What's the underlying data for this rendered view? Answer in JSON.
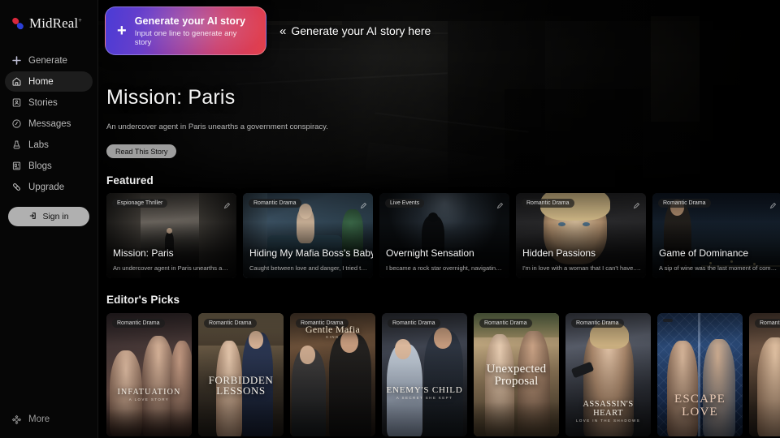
{
  "brand": {
    "name": "MidReal",
    "superscript": "+",
    "logo_icon": "pill-capsule-icon",
    "colors": {
      "pill_red": "#d8283c",
      "pill_blue": "#2b3fd8"
    }
  },
  "sidebar": {
    "items": [
      {
        "label": "Generate",
        "icon": "plus-icon",
        "active": false
      },
      {
        "label": "Home",
        "icon": "home-icon",
        "active": true
      },
      {
        "label": "Stories",
        "icon": "book-icon",
        "active": false
      },
      {
        "label": "Messages",
        "icon": "message-icon",
        "active": false
      },
      {
        "label": "Labs",
        "icon": "flask-icon",
        "active": false
      },
      {
        "label": "Blogs",
        "icon": "newspaper-icon",
        "active": false
      },
      {
        "label": "Upgrade",
        "icon": "capsule-icon",
        "active": false
      }
    ],
    "sign_in": {
      "label": "Sign in",
      "icon": "login-arrow-icon"
    },
    "more": {
      "label": "More",
      "icon": "gear-icon"
    }
  },
  "banner": {
    "title": "Generate your AI story",
    "subtitle": "Input one line to generate any story",
    "plus_icon": "plus-icon",
    "callout_arrows": "«",
    "callout_text": "Generate your AI story here",
    "gradient": {
      "from": "#4a3bd6",
      "to": "#e33f4a"
    }
  },
  "hero": {
    "title": "Mission: Paris",
    "subtitle": "An undercover agent in Paris unearths a government conspiracy.",
    "button_label": "Read This Story"
  },
  "featured": {
    "heading": "Featured",
    "cards": [
      {
        "tag": "Espionage Thriller",
        "title": "Mission: Paris",
        "desc": "An undercover agent in Paris unearths a…",
        "edit_icon": "pencil-icon"
      },
      {
        "tag": "Romantic Drama",
        "title": "Hiding My Mafia Boss's Baby",
        "desc": "Caught between love and danger, I tried to…",
        "edit_icon": "pencil-icon"
      },
      {
        "tag": "Live Events",
        "title": "Overnight Sensation",
        "desc": "I became a rock star overnight, navigating…",
        "edit_icon": "pencil-icon"
      },
      {
        "tag": "Romantic Drama",
        "title": "Hidden Passions",
        "desc": "I'm in love with a woman that I can't have. Ev…",
        "edit_icon": "pencil-icon"
      },
      {
        "tag": "Romantic Drama",
        "title": "Game of Dominance",
        "desc": "A sip of wine was the last moment of comf…",
        "edit_icon": "pencil-icon"
      }
    ]
  },
  "editors_picks": {
    "heading": "Editor's Picks",
    "cards": [
      {
        "tag": "Romantic Drama",
        "poster_title": "INFATUATION",
        "poster_sub": "A LOVE STORY"
      },
      {
        "tag": "Romantic Drama",
        "poster_title": "FORBIDDEN LESSONS",
        "poster_sub": ""
      },
      {
        "tag": "Romantic Drama",
        "poster_title": "Gentle Mafia",
        "poster_sub": "KING"
      },
      {
        "tag": "Romantic Drama",
        "poster_title": "ENEMY'S CHILD",
        "poster_sub": "A SECRET SHE KEPT"
      },
      {
        "tag": "Romantic Drama",
        "poster_title": "Unexpected Proposal",
        "poster_sub": ""
      },
      {
        "tag": "Romantic Drama",
        "poster_title": "ASSASSIN'S HEART",
        "poster_sub": "LOVE IN THE SHADOWS"
      },
      {
        "tag": "",
        "poster_title": "ESCAPE LOVE",
        "poster_sub": ""
      },
      {
        "tag": "Romantic Drama",
        "poster_title": "",
        "poster_sub": ""
      }
    ]
  }
}
